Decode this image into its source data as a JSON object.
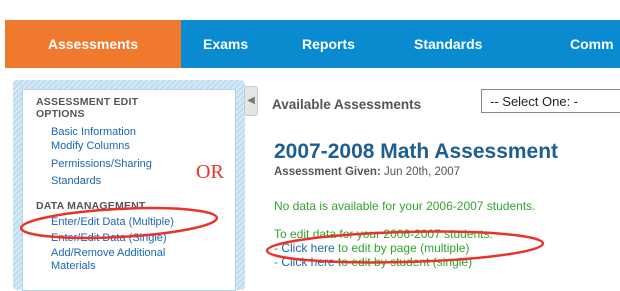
{
  "nav": {
    "tabs": [
      {
        "label": "Assessments",
        "active": true
      },
      {
        "label": "Exams"
      },
      {
        "label": "Reports"
      },
      {
        "label": "Standards"
      },
      {
        "label": "Comm"
      }
    ]
  },
  "sidebar": {
    "section1": {
      "heading_line1": "ASSESSMENT EDIT",
      "heading_line2": "OPTIONS",
      "links": [
        "Basic Information",
        "Modify Columns",
        "Permissions/Sharing",
        "Standards"
      ]
    },
    "section2": {
      "heading": "DATA MANAGEMENT",
      "links": [
        "Enter/Edit Data (Multiple)",
        "Enter/Edit Data (Single)",
        "Add/Remove Additional",
        "Materials"
      ]
    }
  },
  "main": {
    "available_label": "Available Assessments",
    "select_value": "-- Select One: -",
    "title": "2007-2008 Math Assessment",
    "given_label": "Assessment Given:",
    "given_date": "Jun 20th, 2007",
    "no_data": "No data is available for your 2006-2007 students.",
    "edit_intro": "To edit data for your 2006-2007 students:",
    "line1_prefix": "- ",
    "line1_link": "Click here",
    "line1_suffix": " to edit by page (multiple)",
    "line2_prefix": "- ",
    "line2_link": "Click here",
    "line2_suffix": " to edit by student (single)"
  },
  "annotation": {
    "or": "OR",
    "color": "#e8332a"
  },
  "colors": {
    "nav_blue": "#0a8bd0",
    "nav_active_orange": "#ef7a2e",
    "title_blue": "#1e5f90",
    "link_blue": "#1a66b3",
    "green": "#31a52c"
  }
}
